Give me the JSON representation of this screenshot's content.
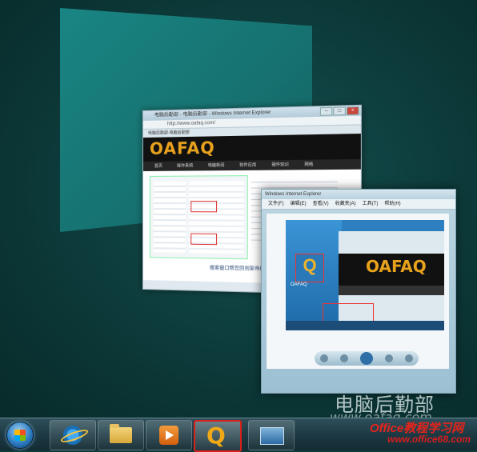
{
  "flip3d": {
    "ie_window": {
      "title": "电脑后勤部 - 电脑后勤部 - Windows Internet Explorer",
      "address": "http://www.oafaq.com/",
      "tab": "电脑后勤部-电脑后勤部",
      "logo": "OAFAQ",
      "nav": [
        "首页",
        "操作系统",
        "电脑新闻",
        "软件应用",
        "硬件知识",
        "网络",
        "其它"
      ],
      "caption": "搜索窗口帮您回到家帝助助"
    },
    "viewer_window": {
      "title": "Windows Internet Explorer",
      "menu": [
        "文件(F)",
        "编辑(E)",
        "查看(V)",
        "收藏夹(A)",
        "工具(T)",
        "帮助(H)"
      ],
      "inner_logo": "OAFAQ",
      "inner_app_label": "OAFAQ"
    }
  },
  "watermark": {
    "chinese": "电脑后勤部",
    "url": "www.oafaq.com"
  },
  "brand": {
    "name": "Office教程学习网",
    "url": "www.office68.com"
  },
  "taskbar": {
    "buttons": [
      {
        "name": "internet-explorer",
        "active": false
      },
      {
        "name": "windows-explorer",
        "active": false
      },
      {
        "name": "media-player",
        "active": false
      },
      {
        "name": "oafaq-app",
        "active": true
      },
      {
        "name": "switch-windows",
        "active": false
      }
    ],
    "active_border_color": "#d8211a"
  },
  "colors": {
    "desktop": "#0e3a3a",
    "blank_window": "#1a8a88",
    "logo": "#e8a21c"
  }
}
